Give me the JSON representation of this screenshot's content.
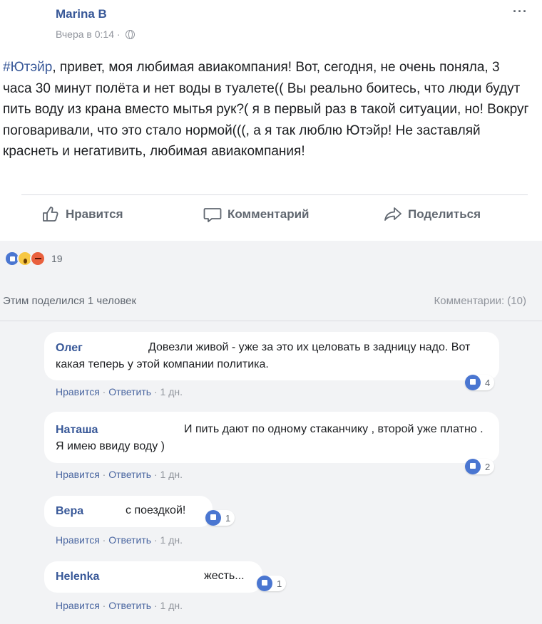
{
  "post": {
    "author": "Marina B",
    "time": "Вчера в 0:14 ·",
    "hashtag": "#Ютэйр",
    "text": ", привет, моя любимая авиакомпания! Вот, сегодня, не очень поняла, 3 часа 30 минут полёта и нет воды в туалете(( Вы реально боитесь, что люди будут пить воду из крана вместо мытья рук?( я в первый раз в такой ситуации, но! Вокруг поговаривали, что это стало нормой(((, а я так люблю Ютэйр! Не заставляй краснеть и негативить, любимая авиакомпания!",
    "menu_icon": "more-dots-icon",
    "privacy_icon": "globe-icon"
  },
  "actions": {
    "like": "Нравится",
    "comment": "Комментарий",
    "share": "Поделиться"
  },
  "stats": {
    "reactions_count": "19",
    "reaction_icons": [
      "like-reaction-icon",
      "wow-reaction-icon",
      "angry-reaction-icon"
    ],
    "shared": "Этим поделился 1 человек",
    "comments": "Комментарии: (10)"
  },
  "comment_links": {
    "like": "Нравится",
    "reply": "Ответить",
    "age": "1 дн."
  },
  "comments": [
    {
      "name": "Олег",
      "text": "Довезли живой - уже за это их целовать в задницу надо. Вот какая теперь у этой компании политика.",
      "likes": "4"
    },
    {
      "name": "Наташа",
      "text": "И пить дают по одному стаканчику , второй уже платно . Я имею ввиду воду )",
      "likes": "2"
    },
    {
      "name": "Вера",
      "text": "с поездкой!",
      "likes": "1"
    },
    {
      "name": "Helenka",
      "text": "жесть...",
      "likes": "1"
    }
  ],
  "colors": {
    "link_blue": "#385898",
    "like_blue": "#4a76d1",
    "gray_text": "#606770",
    "bg": "#f2f3f5"
  }
}
